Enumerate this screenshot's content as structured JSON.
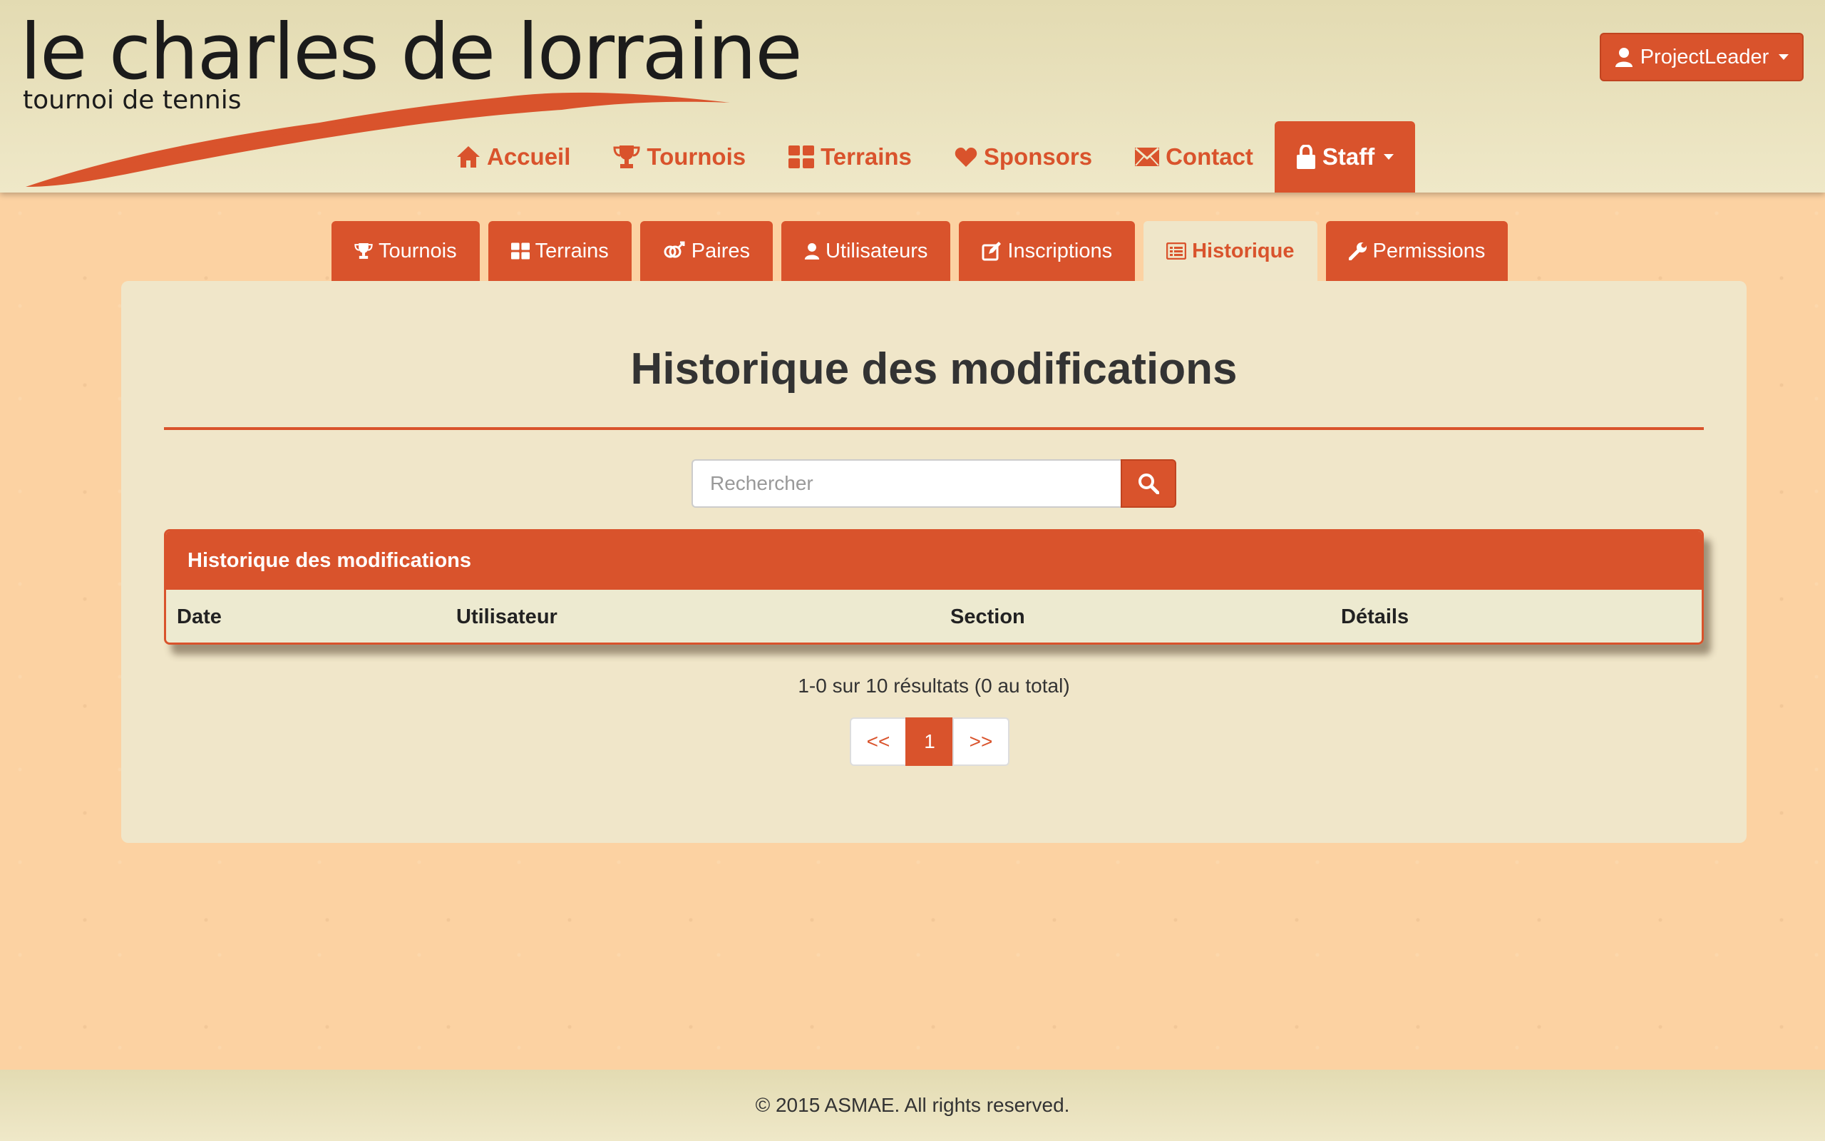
{
  "header": {
    "logo_title": "le charles de lorraine",
    "logo_subtitle": "tournoi de tennis",
    "user_menu_label": "ProjectLeader"
  },
  "main_nav": {
    "items": [
      {
        "label": "Accueil",
        "icon": "home-icon"
      },
      {
        "label": "Tournois",
        "icon": "trophy-icon"
      },
      {
        "label": "Terrains",
        "icon": "grid-icon"
      },
      {
        "label": "Sponsors",
        "icon": "heart-icon"
      },
      {
        "label": "Contact",
        "icon": "envelope-icon"
      },
      {
        "label": "Staff",
        "icon": "lock-icon",
        "active": true
      }
    ]
  },
  "sub_tabs": {
    "items": [
      {
        "label": "Tournois",
        "icon": "trophy-icon"
      },
      {
        "label": "Terrains",
        "icon": "grid-icon"
      },
      {
        "label": "Paires",
        "icon": "gender-icon"
      },
      {
        "label": "Utilisateurs",
        "icon": "user-icon"
      },
      {
        "label": "Inscriptions",
        "icon": "edit-icon"
      },
      {
        "label": "Historique",
        "icon": "list-icon",
        "active": true
      },
      {
        "label": "Permissions",
        "icon": "wrench-icon"
      }
    ]
  },
  "main": {
    "title": "Historique des modifications",
    "search_placeholder": "Rechercher",
    "table": {
      "heading": "Historique des modifications",
      "columns": [
        "Date",
        "Utilisateur",
        "Section",
        "Détails"
      ],
      "rows": []
    },
    "results_summary": "1-0 sur 10 résultats (0 au total)",
    "pagination": {
      "prev": "<<",
      "current": "1",
      "next": ">>"
    }
  },
  "footer": {
    "copyright": "© 2015 ASMAE. All rights reserved."
  },
  "colors": {
    "accent": "#d9532c",
    "panel": "#f0e6c9",
    "background": "#fcd2a2"
  }
}
